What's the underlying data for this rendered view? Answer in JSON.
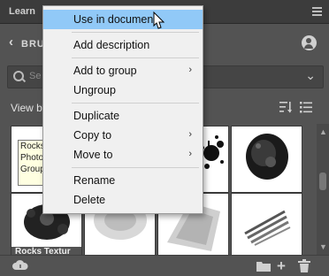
{
  "panel": {
    "tab_label": "Learn",
    "title": "BRUSH",
    "search_placeholder": "Se",
    "view_by": "View by",
    "icons": [
      "panel-menu-icon",
      "back-chevron-icon",
      "user-account-icon",
      "search-icon",
      "chevron-down-icon",
      "sort-icon",
      "list-view-icon",
      "cloud-sync-icon",
      "folder-icon",
      "plus-icon",
      "trash-icon"
    ]
  },
  "grid": {
    "cells": [
      {
        "caption": "Rocks Textur"
      },
      {
        "caption": ""
      },
      {
        "caption": ""
      },
      {
        "caption": ""
      },
      {
        "caption": ""
      },
      {
        "caption": ""
      },
      {
        "caption": ""
      },
      {
        "caption": ""
      }
    ]
  },
  "tooltip": {
    "lines": [
      "Rocks",
      "Photo",
      "Group"
    ]
  },
  "context_menu": {
    "items": [
      {
        "label": "Use in document",
        "highlighted": true,
        "submenu": false
      },
      {
        "label": "Add description",
        "highlighted": false,
        "submenu": false
      },
      {
        "label": "Add to group",
        "highlighted": false,
        "submenu": true
      },
      {
        "label": "Ungroup",
        "highlighted": false,
        "submenu": false
      },
      {
        "label": "Duplicate",
        "highlighted": false,
        "submenu": false
      },
      {
        "label": "Copy to",
        "highlighted": false,
        "submenu": true
      },
      {
        "label": "Move to",
        "highlighted": false,
        "submenu": true
      },
      {
        "label": "Rename",
        "highlighted": false,
        "submenu": false
      },
      {
        "label": "Delete",
        "highlighted": false,
        "submenu": false
      }
    ],
    "submenu_glyph": "›"
  },
  "colors": {
    "panel_bg": "#535353",
    "menu_bg": "#f0f0f0",
    "highlight": "#91c9f7",
    "tooltip_bg": "#ffffe1"
  }
}
